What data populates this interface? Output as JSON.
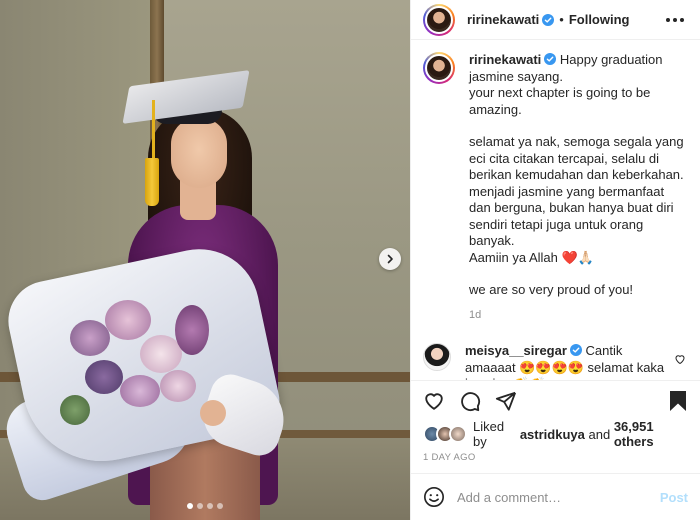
{
  "header": {
    "username": "ririnekawati",
    "separator": "•",
    "follow_label": "Following",
    "verified_icon": "verified-badge-icon",
    "more_icon": "more-options-icon"
  },
  "carousel": {
    "slide_count": 4,
    "active_index": 0,
    "next_icon": "chevron-right-icon"
  },
  "caption": {
    "username": "ririnekawati",
    "paragraphs": [
      "Happy graduation jasmine sayang.",
      "your next chapter is going to be amazing.",
      "selamat ya nak, semoga segala yang eci cita citakan tercapai, selalu di berikan kemudahan dan keberkahan. menjadi jasmine yang bermanfaat dan berguna, bukan hanya buat diri sendiri tetapi juga untuk orang banyak.",
      "Aamiin ya Allah ❤️🙏🏻",
      "we are so very proud of you!"
    ],
    "time": "1d"
  },
  "comment": {
    "username": "meisya__siregar",
    "text": "Cantik amaaaat 😍😍😍😍 selamat kaka jasmine 👏👏",
    "like_icon": "heart-outline-icon"
  },
  "actions": {
    "like_icon": "heart-outline-icon",
    "comment_icon": "comment-bubble-icon",
    "share_icon": "paper-plane-icon",
    "save_icon": "bookmark-filled-icon"
  },
  "likes": {
    "prefix": "Liked by ",
    "liker": "astridkuya",
    "middle": " and ",
    "others": "36,951 others"
  },
  "posted": "1 DAY AGO",
  "add_comment": {
    "placeholder": "Add a comment…",
    "post_label": "Post",
    "emoji_icon": "smiley-face-icon"
  },
  "colors": {
    "verified": "#3897f0",
    "text": "#262626",
    "muted": "#8e8e8e",
    "post_disabled": "#b2dffc",
    "heart": "#ed4956"
  }
}
